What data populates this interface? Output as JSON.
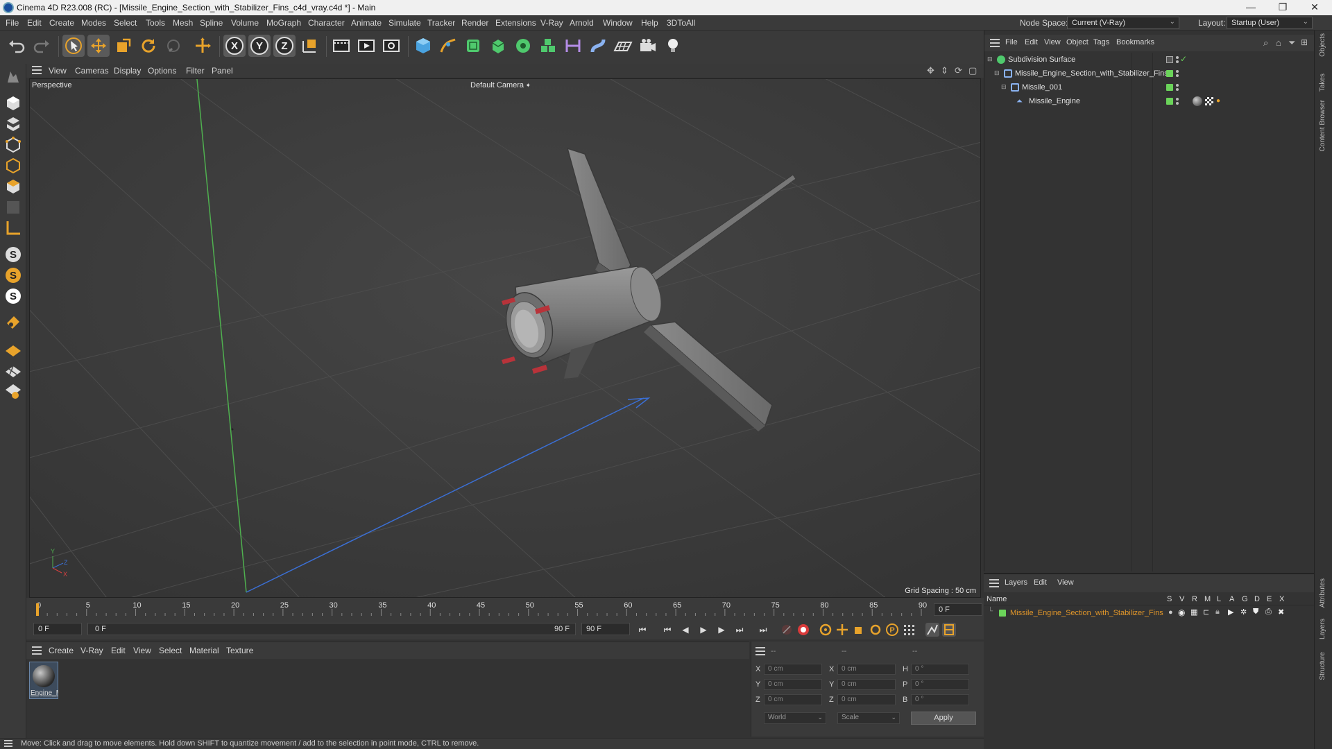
{
  "window": {
    "title": "Cinema 4D R23.008 (RC) - [Missile_Engine_Section_with_Stabilizer_Fins_c4d_vray.c4d *] - Main",
    "controls": [
      "—",
      "❐",
      "✕"
    ]
  },
  "menubar": {
    "items": [
      "File",
      "Edit",
      "Create",
      "Modes",
      "Select",
      "Tools",
      "Mesh",
      "Spline",
      "Volume",
      "MoGraph",
      "Character",
      "Animate",
      "Simulate",
      "Tracker",
      "Render",
      "Extensions",
      "V-Ray",
      "Arnold",
      "Window",
      "Help",
      "3DToAll"
    ],
    "node_space_label": "Node Space:",
    "node_space_value": "Current (V-Ray)",
    "layout_label": "Layout:",
    "layout_value": "Startup (User)"
  },
  "toolbar": {
    "icons": [
      "undo-icon",
      "redo-icon",
      "select-arrow-icon",
      "move-icon",
      "scale-icon",
      "rotate-icon",
      "live-select-icon",
      "add-object-icon",
      "x-axis-icon",
      "y-axis-icon",
      "z-axis-icon",
      "coordinate-system-icon",
      "render-view-icon",
      "render-picture-viewer-icon",
      "render-settings-icon",
      "cube-icon",
      "pen-icon",
      "subdivision-icon",
      "extrude-icon",
      "cloner-icon",
      "mograph-icon",
      "symmetry-icon",
      "deformer-icon",
      "floor-icon",
      "camera-icon",
      "light-icon"
    ],
    "axis_labels": [
      "X",
      "Y",
      "Z"
    ]
  },
  "viewport": {
    "menu": [
      "View",
      "Cameras",
      "Display",
      "Options",
      "Filter",
      "Panel"
    ],
    "label": "Perspective",
    "camera": "Default Camera",
    "grid_spacing": "Grid Spacing : 50 cm",
    "axis_y": "Y",
    "axis_z": "Z",
    "axis_x": "X"
  },
  "timeline": {
    "ticks": [
      "0",
      "5",
      "10",
      "15",
      "20",
      "25",
      "30",
      "35",
      "40",
      "45",
      "50",
      "55",
      "60",
      "65",
      "70",
      "75",
      "80",
      "85",
      "90"
    ],
    "current_frame": "0 F",
    "start_field": "0 F",
    "range_start": "0 F",
    "range_end": "90 F",
    "end_field": "90 F"
  },
  "materials": {
    "menu": [
      "Create",
      "V-Ray",
      "Edit",
      "View",
      "Select",
      "Material",
      "Texture"
    ],
    "items": [
      {
        "name": "Engine_M"
      }
    ]
  },
  "coordinates": {
    "headers": [
      "--",
      "--",
      "--"
    ],
    "rows": [
      {
        "a": "X",
        "av": "0 cm",
        "b": "X",
        "bv": "0 cm",
        "c": "H",
        "cv": "0 °"
      },
      {
        "a": "Y",
        "av": "0 cm",
        "b": "Y",
        "bv": "0 cm",
        "c": "P",
        "cv": "0 °"
      },
      {
        "a": "Z",
        "av": "0 cm",
        "b": "Z",
        "bv": "0 cm",
        "c": "B",
        "cv": "0 °"
      }
    ],
    "mode": "World",
    "scale": "Scale",
    "apply": "Apply"
  },
  "status": {
    "text": "Move: Click and drag to move elements. Hold down SHIFT to quantize movement / add to the selection in point mode, CTRL to remove."
  },
  "object_manager": {
    "menu": [
      "File",
      "Edit",
      "View",
      "Object",
      "Tags",
      "Bookmarks"
    ],
    "objects": [
      {
        "name": "Subdivision Surface"
      },
      {
        "name": "Missile_Engine_Section_with_Stabilizer_Fins"
      },
      {
        "name": "Missile_001"
      },
      {
        "name": "Missile_Engine"
      }
    ]
  },
  "layer_manager": {
    "menu": [
      "Layers",
      "Edit",
      "View"
    ],
    "name_header": "Name",
    "columns": [
      "S",
      "V",
      "R",
      "M",
      "L",
      "A",
      "G",
      "D",
      "E",
      "X"
    ],
    "layers": [
      {
        "name": "Missile_Engine_Section_with_Stabilizer_Fins",
        "color": "#e0962a"
      }
    ]
  },
  "side_tabs": [
    "Objects",
    "Takes",
    "Content Browser",
    "Attributes",
    "Layers",
    "Structure"
  ],
  "colors": {
    "accent_green": "#6bd45a",
    "layer_orange": "#e0962a",
    "record_red": "#d93a3a"
  }
}
